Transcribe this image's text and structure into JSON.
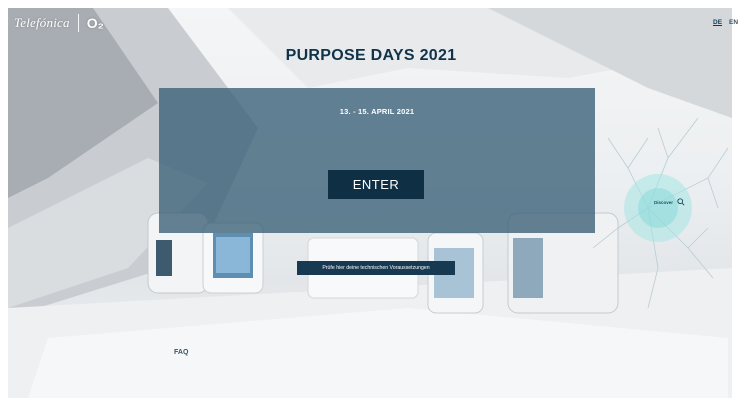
{
  "header": {
    "brand": "Telefónica",
    "brand_o2": "O₂",
    "lang_de": "DE",
    "lang_en": "EN"
  },
  "hero": {
    "title": "PURPOSE DAYS 2021",
    "dates": "13. - 15. APRIL 2021",
    "enter_label": "ENTER"
  },
  "tech_check_label": "Prüfe hier deine technischen Voraussetzungen",
  "faq_label": "FAQ",
  "discover": {
    "label": "Discover",
    "icon": "search-icon"
  },
  "colors": {
    "panel": "#395f76",
    "button": "#0f2f44",
    "title": "#103349"
  }
}
